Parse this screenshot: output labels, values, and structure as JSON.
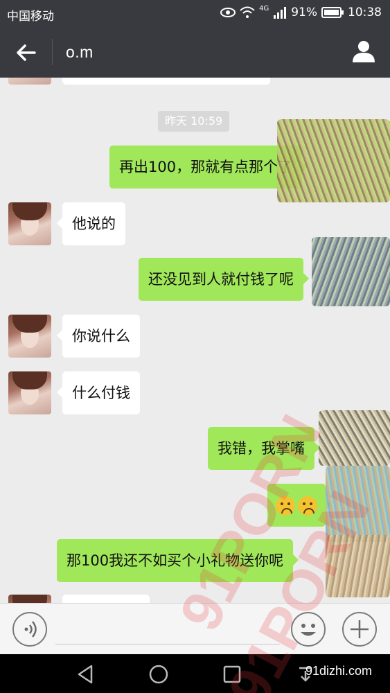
{
  "status_bar": {
    "carrier": "中国移动",
    "network": "4G",
    "battery": "91%",
    "time": "10:38"
  },
  "header": {
    "title": "o.m"
  },
  "chat": {
    "timestamp": "昨天 10:59",
    "messages": [
      {
        "side": "right",
        "text": "再出100，那就有点那个了"
      },
      {
        "side": "left",
        "text": "他说的"
      },
      {
        "side": "right",
        "text": "还没见到人就付钱了呢"
      },
      {
        "side": "left",
        "text": "你说什么"
      },
      {
        "side": "left",
        "text": "什么付钱"
      },
      {
        "side": "right",
        "text": "我错，我掌嘴"
      },
      {
        "side": "right",
        "text": ""
      },
      {
        "side": "right",
        "text": "那100我还不如买个小礼物送你呢"
      }
    ]
  },
  "watermark": {
    "text1": "91PORN",
    "text2": "91PORN",
    "site": "91dizhi.com"
  },
  "icons": {
    "back": "back-arrow-icon",
    "profile": "person-icon",
    "voice": "voice-icon",
    "emoji": "emoji-icon",
    "plus": "plus-icon"
  },
  "colors": {
    "header_bg": "#393a3f",
    "chat_bg": "#ececec",
    "sent_bubble": "#a0e75a",
    "received_bubble": "#ffffff"
  }
}
